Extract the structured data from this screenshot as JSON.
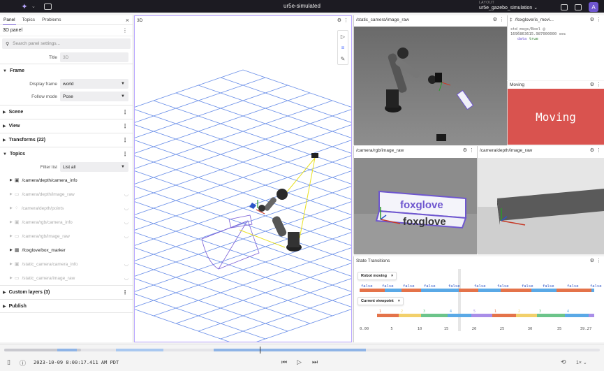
{
  "titlebar": {
    "title": "ur5e-simulated",
    "layout_label": "LAYOUT",
    "layout_value": "ur5e_gazebo_simulation",
    "avatar": "A"
  },
  "sidebar": {
    "tabs": [
      "Panel",
      "Topics",
      "Problems"
    ],
    "panel_name": "3D panel",
    "search_placeholder": "Search panel settings...",
    "title_label": "Title",
    "title_placeholder": "3D",
    "frame_section": "Frame",
    "display_frame_label": "Display frame",
    "display_frame_value": "world",
    "follow_mode_label": "Follow mode",
    "follow_mode_value": "Pose",
    "sections": [
      "Scene",
      "View",
      "Transforms (22)"
    ],
    "topics_section": "Topics",
    "filter_label": "Filter list",
    "filter_value": "List all",
    "topics": [
      {
        "name": "/camera/depth/camera_info",
        "icon": "camera-icon",
        "dim": false
      },
      {
        "name": "/camera/depth/image_raw",
        "icon": "image-icon",
        "dim": true
      },
      {
        "name": "/camera/depth/points",
        "icon": "points-icon",
        "dim": true
      },
      {
        "name": "/camera/rgb/camera_info",
        "icon": "camera-icon",
        "dim": true
      },
      {
        "name": "/camera/rgb/image_raw",
        "icon": "image-icon",
        "dim": true
      },
      {
        "name": "/foxglove/box_marker",
        "icon": "grid-icon",
        "dim": false
      },
      {
        "name": "/static_camera/camera_info",
        "icon": "camera-icon",
        "dim": true
      },
      {
        "name": "/static_camera/image_raw",
        "icon": "image-icon",
        "dim": true
      }
    ],
    "custom_layers": "Custom layers (3)",
    "publish": "Publish"
  },
  "panel3d": {
    "title": "3D"
  },
  "static_cam": {
    "title": "/static_camera/image_raw"
  },
  "raw_msg": {
    "title": "/foxglove/is_movi...",
    "type_line": "std_msgs/Bool @",
    "stamp": "1696863615.987000000 sec",
    "key": "data",
    "value": "true"
  },
  "moving": {
    "title": "Moving",
    "text": "Moving"
  },
  "rgb": {
    "title": "/camera/rgb/image_raw",
    "logo": "foxglove"
  },
  "depth": {
    "title": "/camera/depth/image_raw"
  },
  "state": {
    "title": "State Transitions",
    "series1": "Robot moving",
    "series2": "Current viewpoint",
    "false_label": "false",
    "x_ticks": [
      "0.00",
      "5",
      "10",
      "15",
      "20",
      "25",
      "30",
      "35",
      "39.27"
    ],
    "viewpoint_numbers": [
      "1",
      "2",
      "3",
      "4",
      "5",
      "1",
      "2",
      "3",
      "4"
    ]
  },
  "playback": {
    "time": "2023-10-09 8:00:17.411 AM PDT",
    "speed": "1×"
  },
  "colors": {
    "accent": "#6e56cf",
    "moving_bg": "#d9534f",
    "grid": "#6a8fe8",
    "false_orange": "#e4734a",
    "false_blue": "#5aa9e6"
  }
}
